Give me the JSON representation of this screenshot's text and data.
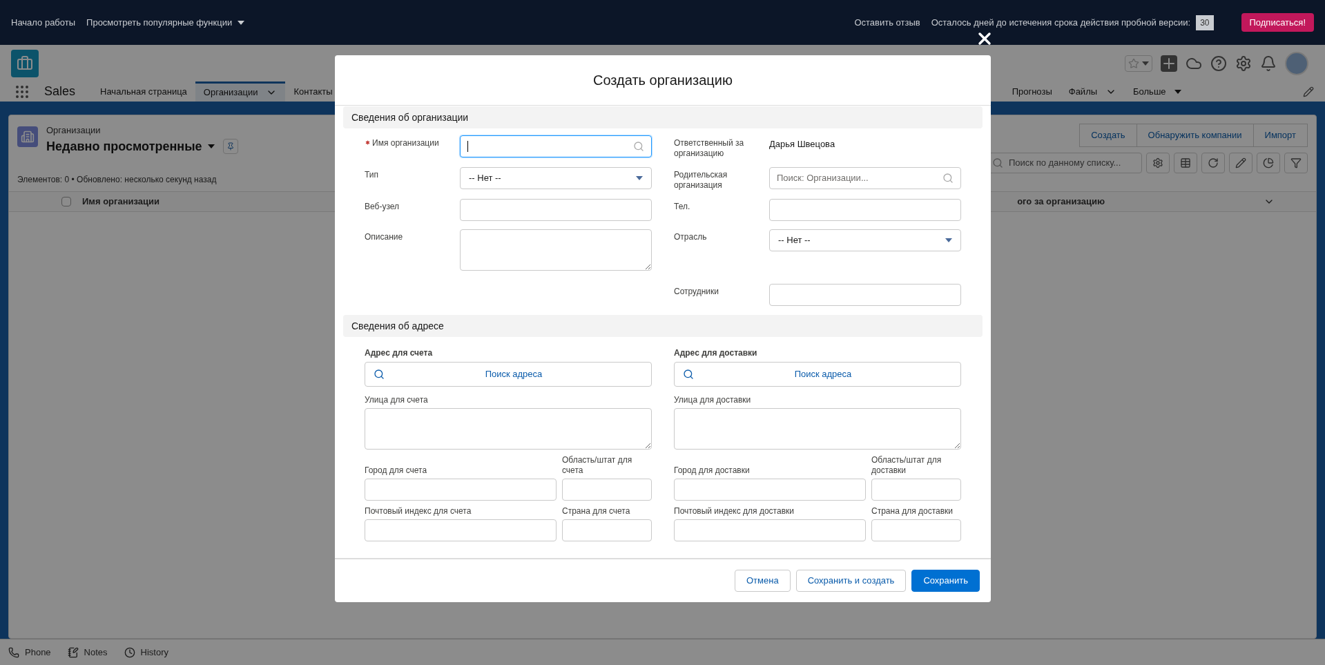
{
  "trial_bar": {
    "links": [
      {
        "label": "Начало работы",
        "has_menu": false
      },
      {
        "label": "Просмотреть популярные функции",
        "has_menu": true
      }
    ],
    "feedback": "Оставить отзыв",
    "trial_text": "Осталось дней до истечения срока действия пробной версии:",
    "days": "30",
    "subscribe": "Подписаться!"
  },
  "app_header": {
    "app_name": "Sales",
    "tabs": [
      {
        "label": "Начальная страница",
        "selected": false,
        "has_menu": false
      },
      {
        "label": "Организации",
        "selected": true,
        "has_menu": true
      },
      {
        "label": "Контакты",
        "selected": false,
        "has_menu": false
      },
      {
        "label": "Прогнозы",
        "selected": false,
        "has_menu": false
      },
      {
        "label": "Файлы",
        "selected": false,
        "has_menu": true
      },
      {
        "label": "Больше",
        "selected": false,
        "has_menu": true
      }
    ]
  },
  "list_view": {
    "object": "Организации",
    "title": "Недавно просмотренные",
    "status": "Элементов: 0 • Обновлено: несколько секунд назад",
    "actions": [
      "Создать",
      "Обнаружить компании",
      "Импорт"
    ],
    "search_placeholder": "Поиск по данному списку...",
    "select_all_checked": false,
    "columns": [
      "Имя организации",
      "ого за организацию"
    ]
  },
  "utility_bar": [
    {
      "label": "Phone",
      "kind": "phone"
    },
    {
      "label": "Notes",
      "kind": "notes"
    },
    {
      "label": "History",
      "kind": "history"
    }
  ],
  "modal": {
    "title": "Создать организацию",
    "sections": [
      {
        "title": "Сведения об организации",
        "kind": "fields",
        "rows": [
          {
            "left": {
              "label": "Имя организации",
              "kind": "lookup",
              "required": true,
              "focused": true
            },
            "right": {
              "label": "Ответственный за организацию",
              "kind": "readonly",
              "value": "Дарья Швецова"
            }
          },
          {
            "left": {
              "label": "Тип",
              "kind": "picklist",
              "value": "-- Нет --",
              "required": false,
              "focused": false
            },
            "right": {
              "label": "Родительская организация",
              "kind": "lookup",
              "placeholder": "Поиск: Организации...",
              "required": false,
              "focused": false
            }
          },
          {
            "left": {
              "label": "Веб-узел",
              "kind": "text",
              "required": false,
              "focused": false
            },
            "right": {
              "label": "Тел.",
              "kind": "text",
              "required": false,
              "focused": false
            }
          },
          {
            "left": {
              "label": "Описание",
              "kind": "textarea",
              "required": false,
              "focused": false
            },
            "right": {
              "label": "Отрасль",
              "kind": "picklist",
              "value": "-- Нет --",
              "required": false,
              "focused": false
            }
          },
          {
            "right": {
              "label": "Сотрудники",
              "kind": "text",
              "required": false,
              "focused": false
            }
          }
        ]
      },
      {
        "title": "Сведения об адресе",
        "kind": "address",
        "columns": [
          {
            "heading": "Адрес для счета",
            "search": "Поиск адреса",
            "street": "Улица для счета",
            "city": "Город для счета",
            "state": "Область/штат для счета",
            "zip": "Почтовый индекс для счета",
            "country": "Страна для счета"
          },
          {
            "heading": "Адрес для доставки",
            "search": "Поиск адреса",
            "street": "Улица для доставки",
            "city": "Город для доставки",
            "state": "Область/штат для доставки",
            "zip": "Почтовый индекс для доставки",
            "country": "Страна для доставки"
          }
        ]
      }
    ],
    "buttons": [
      {
        "label": "Отмена",
        "kind": "neutral"
      },
      {
        "label": "Сохранить и создать",
        "kind": "neutral"
      },
      {
        "label": "Сохранить",
        "kind": "brand"
      }
    ]
  }
}
